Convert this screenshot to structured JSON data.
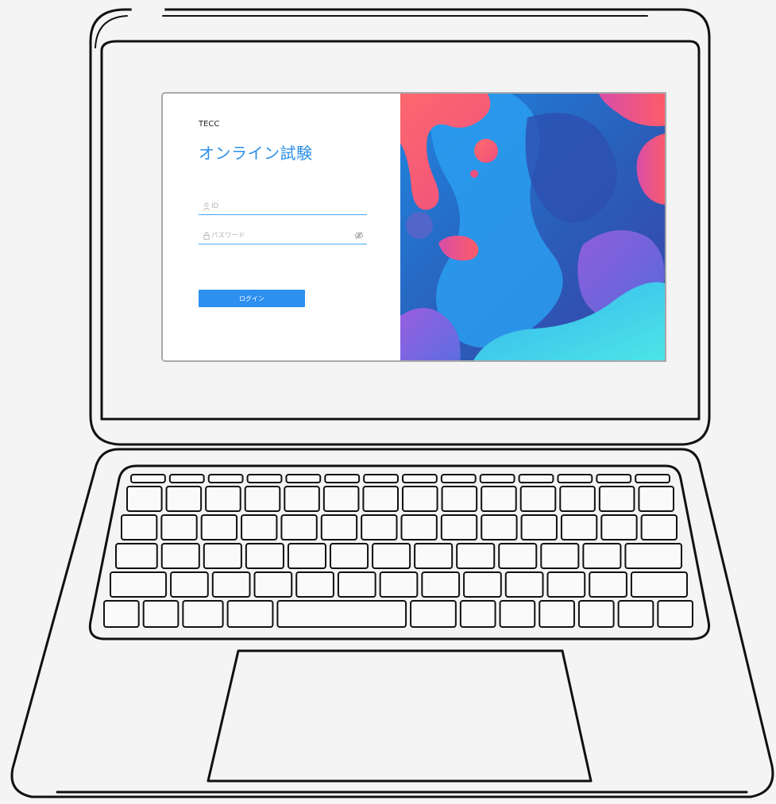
{
  "screen": {
    "brand": "TECC",
    "title": "オンライン試験",
    "id_field": {
      "placeholder": "ID",
      "value": "",
      "icon": "user-icon"
    },
    "password_field": {
      "placeholder": "パスワード",
      "value": "",
      "icon": "lock-icon",
      "toggle_icon": "eye-off-icon"
    },
    "login_button": "ログイン",
    "colors": {
      "accent": "#2a8fe6",
      "button": "#2d8ff0",
      "art_blue_dark": "#2a5cb8",
      "art_blue_light": "#1e8de8",
      "art_pink": "#f25f72",
      "art_purple": "#8b5bd6",
      "art_cyan": "#3fd9e6"
    }
  }
}
